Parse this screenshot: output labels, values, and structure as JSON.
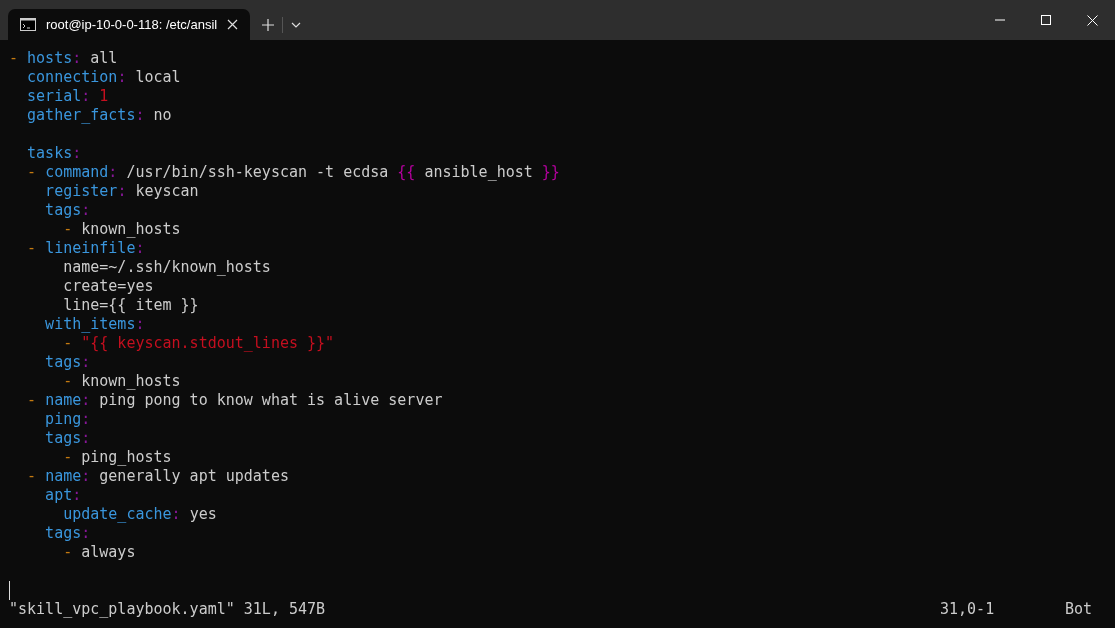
{
  "tab": {
    "title": "root@ip-10-0-0-118: /etc/ansil",
    "selected": true
  },
  "lines": [
    [
      {
        "kind": "dash",
        "text": "- "
      },
      {
        "kind": "key",
        "text": "hosts"
      },
      {
        "kind": "colon",
        "text": ": "
      },
      {
        "kind": "plain",
        "text": "all"
      }
    ],
    [
      {
        "kind": "key",
        "text": "  connection"
      },
      {
        "kind": "colon",
        "text": ": "
      },
      {
        "kind": "plain",
        "text": "local"
      }
    ],
    [
      {
        "kind": "key",
        "text": "  serial"
      },
      {
        "kind": "colon",
        "text": ": "
      },
      {
        "kind": "number",
        "text": "1"
      }
    ],
    [
      {
        "kind": "key",
        "text": "  gather_facts"
      },
      {
        "kind": "colon",
        "text": ": "
      },
      {
        "kind": "plain",
        "text": "no"
      }
    ],
    [
      {
        "kind": "blank"
      }
    ],
    [
      {
        "kind": "key",
        "text": "  tasks"
      },
      {
        "kind": "colon",
        "text": ":"
      }
    ],
    [
      {
        "kind": "dash",
        "text": "  - "
      },
      {
        "kind": "key",
        "text": "command"
      },
      {
        "kind": "colon",
        "text": ": "
      },
      {
        "kind": "plain",
        "text": "/usr/bin/ssh-keyscan -t ecdsa "
      },
      {
        "kind": "brace",
        "text": "{{"
      },
      {
        "kind": "plain",
        "text": " ansible_host "
      },
      {
        "kind": "brace",
        "text": "}}"
      }
    ],
    [
      {
        "kind": "key",
        "text": "    register"
      },
      {
        "kind": "colon",
        "text": ": "
      },
      {
        "kind": "plain",
        "text": "keyscan"
      }
    ],
    [
      {
        "kind": "key",
        "text": "    tags"
      },
      {
        "kind": "colon",
        "text": ":"
      }
    ],
    [
      {
        "kind": "dash",
        "text": "      - "
      },
      {
        "kind": "plain",
        "text": "known_hosts"
      }
    ],
    [
      {
        "kind": "dash",
        "text": "  - "
      },
      {
        "kind": "key",
        "text": "lineinfile"
      },
      {
        "kind": "colon",
        "text": ":"
      }
    ],
    [
      {
        "kind": "plain",
        "text": "      name=~/.ssh/known_hosts"
      }
    ],
    [
      {
        "kind": "plain",
        "text": "      create=yes"
      }
    ],
    [
      {
        "kind": "plain",
        "text": "      line={{ item }}"
      }
    ],
    [
      {
        "kind": "key",
        "text": "    with_items"
      },
      {
        "kind": "colon",
        "text": ":"
      }
    ],
    [
      {
        "kind": "dash",
        "text": "      - "
      },
      {
        "kind": "string",
        "text": "\"{{ keyscan.stdout_lines }}\""
      }
    ],
    [
      {
        "kind": "key",
        "text": "    tags"
      },
      {
        "kind": "colon",
        "text": ":"
      }
    ],
    [
      {
        "kind": "dash",
        "text": "      - "
      },
      {
        "kind": "plain",
        "text": "known_hosts"
      }
    ],
    [
      {
        "kind": "dash",
        "text": "  - "
      },
      {
        "kind": "key",
        "text": "name"
      },
      {
        "kind": "colon",
        "text": ": "
      },
      {
        "kind": "plain",
        "text": "ping pong to know what is alive server"
      }
    ],
    [
      {
        "kind": "key",
        "text": "    ping"
      },
      {
        "kind": "colon",
        "text": ":"
      }
    ],
    [
      {
        "kind": "key",
        "text": "    tags"
      },
      {
        "kind": "colon",
        "text": ":"
      }
    ],
    [
      {
        "kind": "dash",
        "text": "      - "
      },
      {
        "kind": "plain",
        "text": "ping_hosts"
      }
    ],
    [
      {
        "kind": "dash",
        "text": "  - "
      },
      {
        "kind": "key",
        "text": "name"
      },
      {
        "kind": "colon",
        "text": ": "
      },
      {
        "kind": "plain",
        "text": "generally apt updates"
      }
    ],
    [
      {
        "kind": "key",
        "text": "    apt"
      },
      {
        "kind": "colon",
        "text": ":"
      }
    ],
    [
      {
        "kind": "key",
        "text": "      update_cache"
      },
      {
        "kind": "colon",
        "text": ": "
      },
      {
        "kind": "plain",
        "text": "yes"
      }
    ],
    [
      {
        "kind": "key",
        "text": "    tags"
      },
      {
        "kind": "colon",
        "text": ":"
      }
    ],
    [
      {
        "kind": "dash",
        "text": "      - "
      },
      {
        "kind": "plain",
        "text": "always"
      }
    ]
  ],
  "status_bar": {
    "file_info": "\"skill_vpc_playbook.yaml\" 31L, 547B",
    "position": "31,0-1",
    "scroll": "Bot"
  }
}
